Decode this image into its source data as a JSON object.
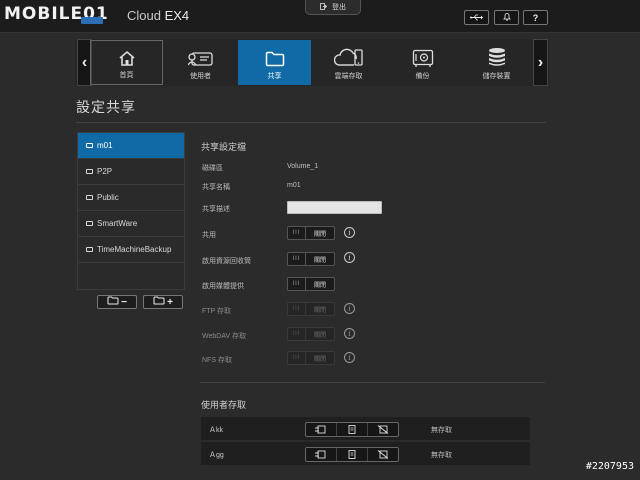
{
  "header": {
    "watermark_logo": "MOBILE01",
    "brand_prefix": "My",
    "brand_name": "Cloud",
    "brand_model": "EX4",
    "logout_label": "登出",
    "icons": [
      "usb-icon",
      "bell-icon",
      "help-icon"
    ],
    "help_label": "?"
  },
  "nav": {
    "prev": "‹",
    "next": "›",
    "items": [
      {
        "label": "首頁",
        "icon": "home-icon"
      },
      {
        "label": "使用者",
        "icon": "users-icon"
      },
      {
        "label": "共享",
        "icon": "folder-icon",
        "active": true
      },
      {
        "label": "雲端存取",
        "icon": "cloud-icon"
      },
      {
        "label": "備份",
        "icon": "safe-icon"
      },
      {
        "label": "儲存裝置",
        "icon": "storage-icon"
      }
    ]
  },
  "page": {
    "title": "設定共享",
    "shares": [
      "m01",
      "P2P",
      "Public",
      "SmartWare",
      "TimeMachineBackup"
    ],
    "selected_share": "m01",
    "remove_label": "−",
    "add_label": "+"
  },
  "profile": {
    "title": "共享設定檔",
    "rows": [
      {
        "label": "磁碟區",
        "value": "Volume_1"
      },
      {
        "label": "共享名稱",
        "value": "m01"
      },
      {
        "label": "共享描述",
        "value": ""
      }
    ],
    "toggles": [
      {
        "label": "共用",
        "state": "關閉",
        "enabled": true
      },
      {
        "label": "啟用資源回收筒",
        "state": "關閉",
        "enabled": true
      },
      {
        "label": "啟用媒體提供",
        "state": "關閉",
        "enabled": true
      },
      {
        "label": "FTP 存取",
        "state": "關閉",
        "enabled": false
      },
      {
        "label": "WebDAV 存取",
        "state": "關閉",
        "enabled": false
      },
      {
        "label": "NFS 存取",
        "state": "關閉",
        "enabled": false
      }
    ],
    "toggle_grip": "III",
    "info_glyph": "i"
  },
  "user_access": {
    "title": "使用者存取",
    "users": [
      {
        "name": "kk",
        "access": "無存取"
      },
      {
        "name": "gg",
        "access": "無存取"
      }
    ]
  },
  "watermark_id": "#2207953",
  "colors": {
    "accent": "#0f6aa6",
    "background": "#2b2b2b"
  }
}
